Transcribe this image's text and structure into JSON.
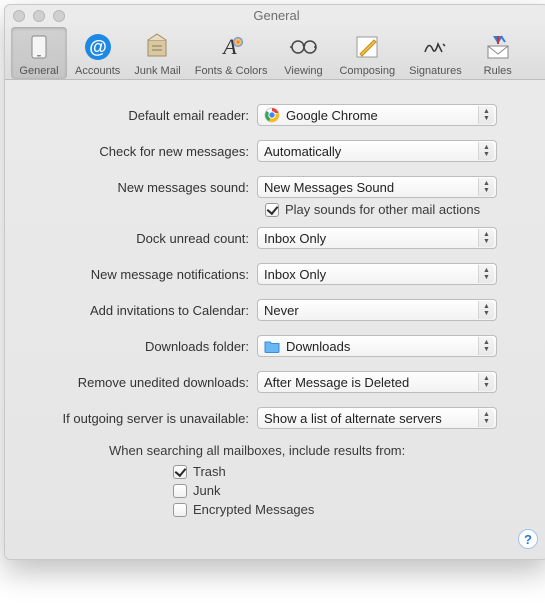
{
  "window": {
    "title": "General"
  },
  "toolbar": {
    "items": [
      {
        "label": "General",
        "icon": "general-icon"
      },
      {
        "label": "Accounts",
        "icon": "accounts-icon"
      },
      {
        "label": "Junk Mail",
        "icon": "junkmail-icon"
      },
      {
        "label": "Fonts & Colors",
        "icon": "fonts-colors-icon"
      },
      {
        "label": "Viewing",
        "icon": "viewing-icon"
      },
      {
        "label": "Composing",
        "icon": "composing-icon"
      },
      {
        "label": "Signatures",
        "icon": "signatures-icon"
      },
      {
        "label": "Rules",
        "icon": "rules-icon"
      }
    ],
    "selected_index": 0
  },
  "labels": {
    "default_reader": "Default email reader:",
    "check_messages": "Check for new messages:",
    "new_sound": "New messages sound:",
    "play_sounds": "Play sounds for other mail actions",
    "dock_unread": "Dock unread count:",
    "notifications": "New message notifications:",
    "add_invites": "Add invitations to Calendar:",
    "downloads": "Downloads folder:",
    "remove_downloads": "Remove unedited downloads:",
    "outgoing_unavailable": "If outgoing server is unavailable:",
    "search_heading": "When searching all mailboxes, include results from:",
    "trash": "Trash",
    "junk": "Junk",
    "encrypted": "Encrypted Messages"
  },
  "values": {
    "default_reader": "Google Chrome",
    "check_messages": "Automatically",
    "new_sound": "New Messages Sound",
    "play_sounds_checked": true,
    "dock_unread": "Inbox Only",
    "notifications": "Inbox Only",
    "add_invites": "Never",
    "downloads": "Downloads",
    "remove_downloads": "After Message is Deleted",
    "outgoing_unavailable": "Show a list of alternate servers",
    "trash_checked": true,
    "junk_checked": false,
    "encrypted_checked": false
  },
  "icons": {
    "default_reader": "chrome-icon",
    "downloads": "folder-icon"
  },
  "help": "?"
}
